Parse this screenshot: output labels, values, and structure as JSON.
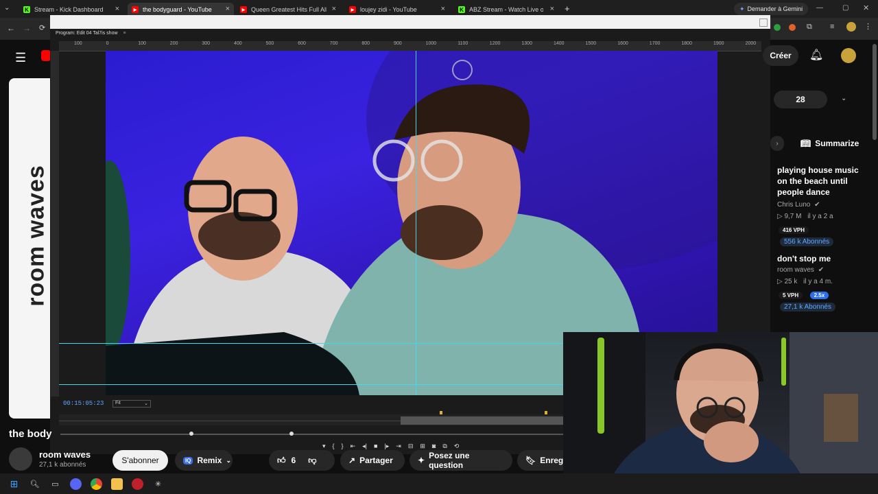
{
  "tabs": [
    {
      "label": "Stream - Kick Dashboard",
      "icon": "kick-icon",
      "icon_glyph": "K",
      "icon_color": "#53fc18"
    },
    {
      "label": "the bodyguard - YouTube",
      "icon": "youtube-icon",
      "icon_glyph": "▶",
      "icon_color": "#ff0000"
    },
    {
      "label": "Queen Greatest Hits Full Album",
      "icon": "youtube-icon",
      "icon_glyph": "▶",
      "icon_color": "#ff0000"
    },
    {
      "label": "loujey zidi - YouTube",
      "icon": "youtube-icon",
      "icon_glyph": "▶",
      "icon_color": "#ff0000"
    },
    {
      "label": "ABZ Stream - Watch Live on Kick",
      "icon": "kick-icon",
      "icon_glyph": "K",
      "icon_color": "#53fc18"
    }
  ],
  "new_tab": "+",
  "gemini_label": "Demander à Gemini",
  "editor": {
    "program_label": "Program: Edit 04 Tal7is show",
    "ruler_labels": [
      "100",
      "0",
      "100",
      "200",
      "300",
      "400",
      "500",
      "600",
      "700",
      "800",
      "900",
      "1000",
      "1100",
      "1200",
      "1300",
      "1400",
      "1500",
      "1600",
      "1700",
      "1800",
      "1900",
      "2000"
    ],
    "timecode": "00:15:05:23",
    "fit_label": "Fit",
    "transport": [
      "▾",
      "{",
      "}",
      "⇤",
      "◂|",
      "■",
      "|▸",
      "⇥",
      "⊟",
      "⊞",
      "◙",
      "⧉",
      "⟲"
    ]
  },
  "youtube": {
    "banner_text": "room waves",
    "video_title": "the body",
    "channel_name": "room waves",
    "channel_subs": "27,1 k abonnés",
    "subscribe": "S'abonner",
    "remix": "Remix",
    "likes": "6",
    "share": "Partager",
    "ask": "Posez une question",
    "save": "Enregis",
    "create": "Créer",
    "count_pill": "28",
    "summarize": "Summarize",
    "recommended": [
      {
        "title": "playing house music on the beach until people dance",
        "channel": "Chris Luno",
        "views": "▷ 9,7 M",
        "age": "il y a 2 a",
        "vph": "416 VPH",
        "subs": "556 k Abonnés"
      },
      {
        "title": "don't stop me",
        "channel": "room waves",
        "views": "▷ 25 k",
        "age": "il y a 4 m.",
        "vph": "5 VPH",
        "multiplier": "2.5x",
        "subs": "27,1 k Abonnés"
      }
    ]
  },
  "colors": {
    "accent_blue": "#5fa8ff",
    "guide": "#44d8f0",
    "youtube_red": "#ff0000"
  }
}
